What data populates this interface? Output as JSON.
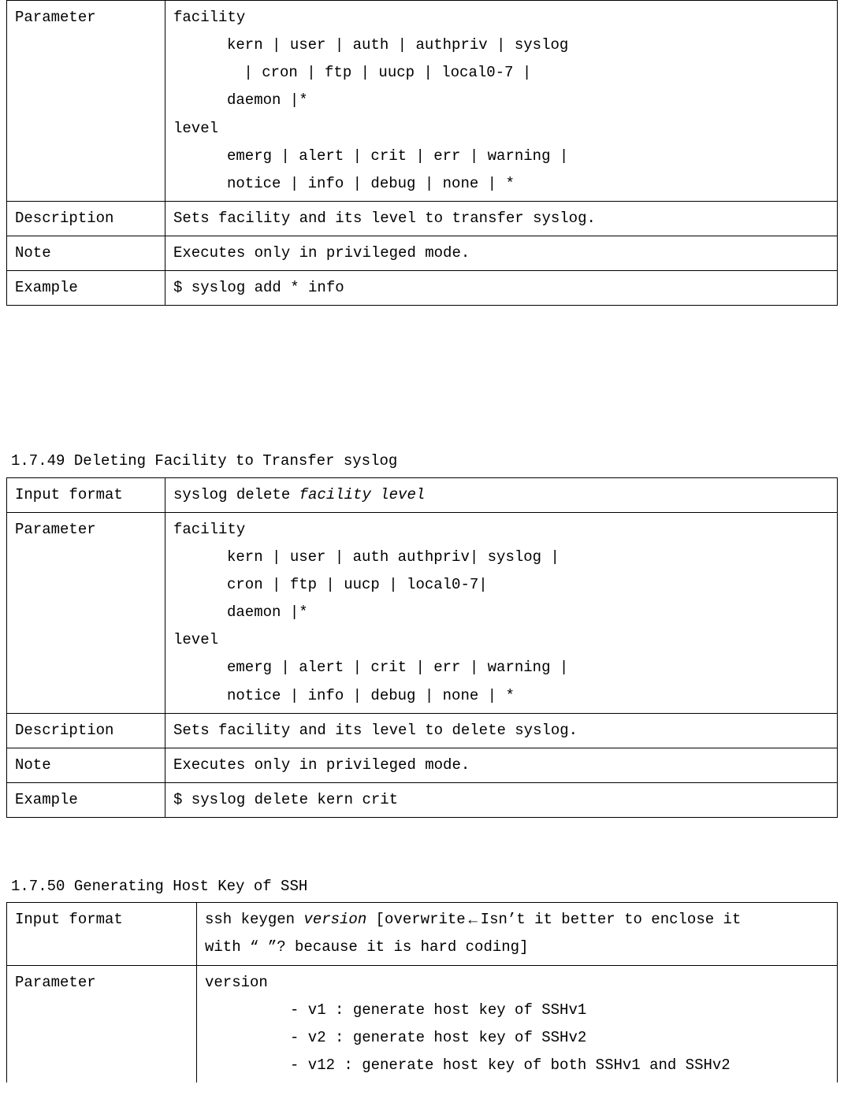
{
  "labels": {
    "input_format": "Input format",
    "parameter": "Parameter",
    "description": "Description",
    "note": "Note",
    "example": "Example"
  },
  "table1": {
    "param": {
      "facility_word": "facility",
      "fac_line1": "kern | user | auth | authpriv | syslog",
      "fac_line2": " | cron | ftp | uucp | local0-7 |",
      "fac_line3": "daemon |*",
      "level_word": "level",
      "lvl_line1": "emerg | alert | crit | err | warning |",
      "lvl_line2": "notice | info | debug | none | *"
    },
    "description": "Sets facility and its level to transfer syslog.",
    "note": "Executes only in privileged mode.",
    "example": "$ syslog add * info"
  },
  "section2": {
    "heading": "1.7.49 Deleting Facility to Transfer syslog",
    "input_format_pre": "syslog delete ",
    "input_format_args": "facility level",
    "param": {
      "facility_word": "facility",
      "fac_line1": "kern | user | auth authpriv| syslog |",
      "fac_line2": "cron | ftp | uucp | local0-7|",
      "fac_line3": "daemon |*",
      "level_word": "level",
      "lvl_line1": "emerg | alert | crit | err | warning |",
      "lvl_line2": "notice | info | debug | none | *"
    },
    "description": "Sets facility and its level to delete syslog.",
    "note": "Executes only in privileged mode.",
    "example": "$ syslog delete kern crit"
  },
  "section3": {
    "heading": "1.7.50 Generating Host Key of SSH",
    "input_format_pre": " ssh keygen ",
    "input_format_arg": "version",
    "input_format_mid": " [overwrite",
    "input_format_tail1": "Isn’t it better to enclose it",
    "input_format_tail2": "with “ ”? because it is hard coding]",
    "param": {
      "version_word": "version",
      "v1": "- v1 : generate host key of SSHv1",
      "v2": "- v2 : generate host key of SSHv2",
      "v12": "- v12 : generate host key of both SSHv1 and SSHv2"
    }
  }
}
